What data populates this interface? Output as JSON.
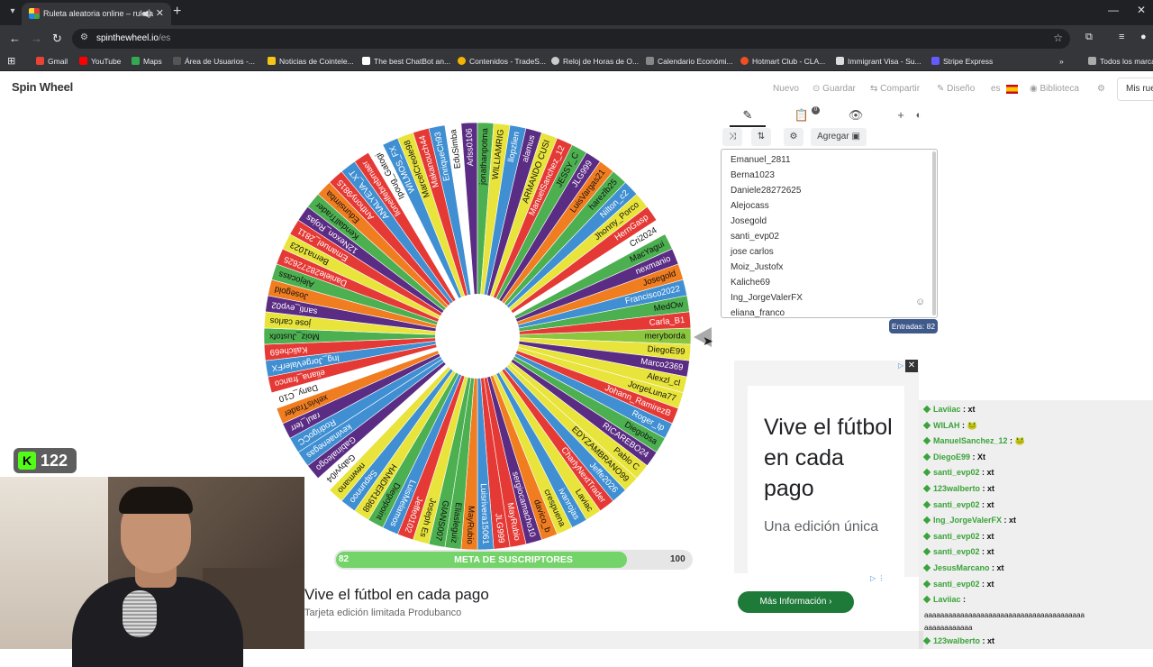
{
  "browser": {
    "tab_title": "Ruleta aleatoria online – ruleta",
    "url_host": "spinthewheel.io",
    "url_path": "/es",
    "bookmarks": [
      "Gmail",
      "YouTube",
      "Maps",
      "Área de Usuarios -...",
      "Noticias de Cointele...",
      "The best ChatBot an...",
      "Contenidos - TradeS...",
      "Reloj de Horas de O...",
      "Calendario Económi...",
      "Hotmart Club - CLA...",
      "Immigrant Visa - Su...",
      "Stripe Express",
      "Todos los marca"
    ]
  },
  "header": {
    "logo": "Spin Wheel",
    "links": [
      "Nuevo",
      "Guardar",
      "Compartir",
      "Diseño",
      "es",
      "Biblioteca"
    ],
    "account": "Mis rue"
  },
  "wheel": {
    "colors": [
      "#8cc63f",
      "#e8e43c",
      "#5b2c83",
      "#e8e43c",
      "#e8e43c",
      "#e53935",
      "#3f8fd2",
      "#4caf50",
      "#5b2c83",
      "#e8e43c",
      "#e8e43c",
      "#3f8fd2",
      "#e53935",
      "#e8e43c",
      "#3f8fd2",
      "#e8e43c",
      "#f07d20",
      "#5b2c83",
      "#e53935",
      "#e53935",
      "#3f8fd2",
      "#f07d20",
      "#4caf50",
      "#4caf50",
      "#e8e43c",
      "#e53935",
      "#3f8fd2",
      "#4caf50",
      "#e8e43c",
      "#3f8fd2",
      "#e8e43c",
      "#ffffff",
      "#5b2c83",
      "#3f8fd2",
      "#3f8fd2",
      "#5b2c83",
      "#f07d20",
      "#ffffff",
      "#e53935",
      "#3f8fd2",
      "#e53935",
      "#4caf50",
      "#e8e43c",
      "#5b2c83",
      "#f07d20",
      "#4caf50",
      "#e53935",
      "#e8e43c",
      "#e53935",
      "#5b2c83",
      "#4caf50",
      "#f07d20",
      "#e53935",
      "#3f8fd2",
      "#e53935",
      "#ffffff",
      "#3f8fd2",
      "#e8e43c",
      "#e53935",
      "#3f8fd2",
      "#ffffff",
      "#5b2c83",
      "#4caf50",
      "#e8e43c",
      "#3f8fd2",
      "#5b2c83",
      "#e8e43c",
      "#e53935",
      "#4caf50",
      "#5b2c83",
      "#f07d20",
      "#4caf50",
      "#3f8fd2",
      "#e8e43c",
      "#e53935",
      "#ffffff",
      "#4caf50",
      "#5b2c83",
      "#f07d20",
      "#3f8fd2",
      "#4caf50",
      "#e53935"
    ],
    "labels": [
      "meryborda",
      "DiegoE99",
      "Marco2369",
      "Alexzl_cl",
      "JorgeLuna77",
      "Johann_RamirezB",
      "Roger_tp",
      "Diegobsa",
      "RICAREBO24",
      "Pablo C",
      "EDYZAMBRANO99",
      "Jeffe2026",
      "CharlyNextTrader",
      "Laviac",
      "ivanrojas",
      "crespuena",
      "davico_b",
      "sergiocamacho10",
      "MayRubio",
      "JLG999",
      "Luisrivera15061",
      "MayRubio",
      "Eliasleguiz",
      "GIANS007",
      "Joseph Es",
      "Jeffe0102",
      "LuisMelamos",
      "Diegopoint",
      "HANDER1988",
      "Sapunnoo",
      "newmano",
      "Gabyvi04",
      "Gabinaleogo",
      "kevinaenegas",
      "RodrigoCC",
      "raul_ferr",
      "xelvisTrader",
      "Dany_C10",
      "eliana_franco",
      "Ing_JorgeValerFX",
      "Kaliche69",
      "Moiz_Justofx",
      "jose carlos",
      "santi_evp02",
      "Josegold",
      "Alejocass",
      "Daniele28272625",
      "Berna1023",
      "Emanuel_2811",
      "12Nexon_Rojas",
      "KendallTrader",
      "Edunsimba",
      "Anthony9815",
      "ANALYEVA_XT",
      "lionelfebrebmaer",
      "Ipoug_Gatogi",
      "WILMOS_FX",
      "MarcelCreole98",
      "Makanouch44",
      "EnriqueCh93",
      "EduSimba",
      "Arlss0106",
      "jonathanpotma",
      "WILLIAMRIG",
      "llopzlien",
      "alamus",
      "ARMANDO CUSI",
      "ManuelSanchez_12",
      "JESSY_C",
      "JLG999",
      "LuisVargas21",
      "harezlb25",
      "Nilton_c2",
      "Jhonny_Porco",
      "HernGasp",
      "Cri2024",
      "MacYagui",
      "nexmanio",
      "Josegold",
      "Francisco2022",
      "MedOw",
      "Carla_B1"
    ]
  },
  "progress": {
    "label": "META DE SUSCRIPTORES",
    "start": "82",
    "end": "100",
    "value": 82,
    "max": 100
  },
  "panel": {
    "tabs": [
      "✎",
      "📋",
      "👁",
      "+"
    ],
    "tool_add": "Agregar",
    "entries": [
      "Emanuel_2811",
      "Berna1023",
      "Daniele28272625",
      "Alejocass",
      "Josegold",
      "santi_evp02",
      "jose carlos",
      "Moiz_Justofx",
      "Kaliche69",
      "Ing_JorgeValerFX",
      "eliana_franco"
    ],
    "count_label": "Entradas: 82"
  },
  "ad_right": {
    "title": "Vive el fútbol en cada pago",
    "subtitle": "Una edición única"
  },
  "ad_bottom": {
    "title": "Vive el fútbol en cada pago",
    "subtitle": "Tarjeta edición limitada Produbanco",
    "button": "Más Información"
  },
  "overlay": {
    "kick_count": "122"
  },
  "chat": [
    {
      "user": "Laviiac",
      "msg": ": xt"
    },
    {
      "user": "WILAH",
      "msg": ": 🐸"
    },
    {
      "user": "ManuelSanchez_12",
      "msg": ": 🐸"
    },
    {
      "user": "DiegoE99",
      "msg": ": Xt"
    },
    {
      "user": "santi_evp02",
      "msg": ": xt"
    },
    {
      "user": "123walberto",
      "msg": ": xt"
    },
    {
      "user": "santi_evp02",
      "msg": ": xt"
    },
    {
      "user": "Ing_JorgeValerFX",
      "msg": ": xt"
    },
    {
      "user": "santi_evp02",
      "msg": ": xt"
    },
    {
      "user": "santi_evp02",
      "msg": ": xt"
    },
    {
      "user": "JesusMarcano",
      "msg": ": xt"
    },
    {
      "user": "santi_evp02",
      "msg": ": xt"
    },
    {
      "user": "Laviiac",
      "msg": ":"
    },
    {
      "user": "",
      "msg": "aaaaaaaaaaaaaaaaaaaaaaaaaaaaaaaaaaaaaaaa"
    },
    {
      "user": "",
      "msg": "aaaaaaaaaaaa"
    },
    {
      "user": "123walberto",
      "msg": ": xt"
    }
  ]
}
